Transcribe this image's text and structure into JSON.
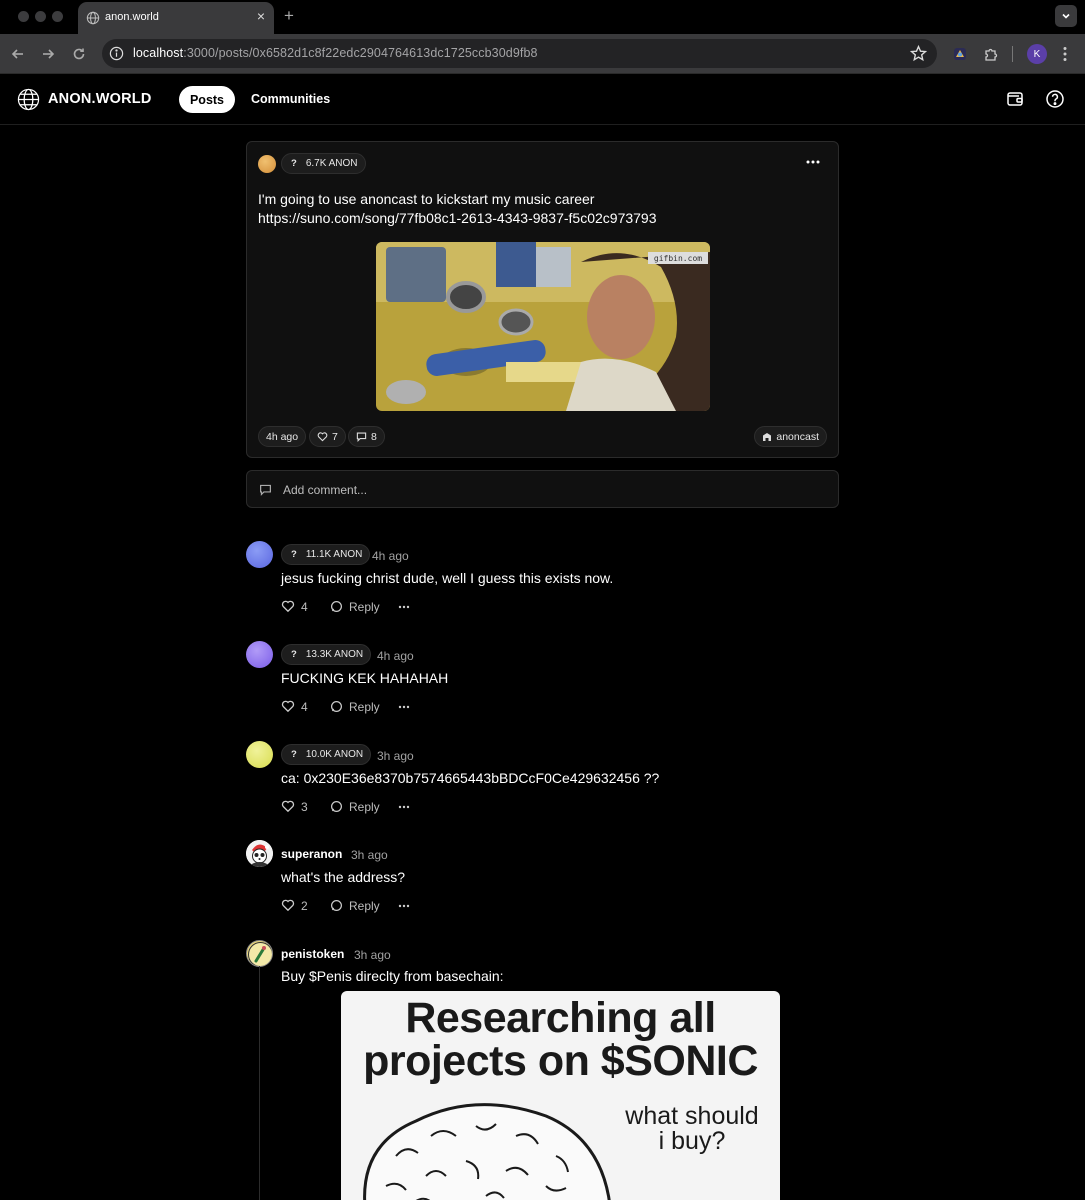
{
  "browser": {
    "tab_title": "anon.world",
    "url_host": "localhost",
    "url_rest": ":3000/posts/0x6582d1c8f22edc2904764613dc1725ccb30d9fb8",
    "profile_initial": "K"
  },
  "header": {
    "logo_text": "ANON.WORLD",
    "nav": {
      "posts": "Posts",
      "communities": "Communities"
    }
  },
  "post": {
    "badge": {
      "icon": "?",
      "label": "6.7K ANON"
    },
    "text_line1": "I'm going to use anoncast to kickstart my music career",
    "text_line2": "https://suno.com/song/77fb08c1-2613-4343-9837-f5c02c973793",
    "media_watermark": "gifbin.com",
    "time": "4h ago",
    "likes": "7",
    "comments": "8",
    "community": "anoncast"
  },
  "comment_box": {
    "placeholder": "Add comment..."
  },
  "comments": [
    {
      "badge_icon": "?",
      "badge": "11.1K ANON",
      "time": "4h ago",
      "text": "jesus fucking christ dude, well I guess this exists now.",
      "likes": "4",
      "reply": "Reply",
      "avatar_color": "#6f7ff0"
    },
    {
      "badge_icon": "?",
      "badge": "13.3K ANON",
      "time": "4h ago",
      "text": "FUCKING KEK HAHAHAH",
      "likes": "4",
      "reply": "Reply",
      "avatar_color": "#8f72f0"
    },
    {
      "badge_icon": "?",
      "badge": "10.0K ANON",
      "time": "3h ago",
      "text": "ca: 0x230E36e8370b7574665443bBDCcF0Ce429632456 ??",
      "likes": "3",
      "reply": "Reply",
      "avatar_color": "#e3e86a"
    },
    {
      "name": "superanon",
      "time": "3h ago",
      "text": "what's the address?",
      "likes": "2",
      "reply": "Reply"
    },
    {
      "name": "penistoken",
      "time": "3h ago",
      "text": "Buy $Penis direclty from basechain:"
    }
  ],
  "meme": {
    "title_line1": "Researching all",
    "title_line2": "projects on $SONIC",
    "side_line1": "what should",
    "side_line2": "i buy?"
  }
}
